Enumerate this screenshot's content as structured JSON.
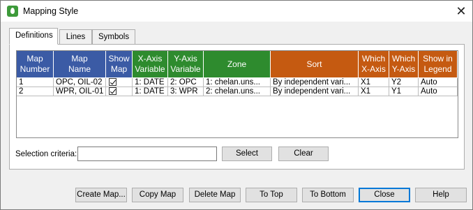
{
  "window": {
    "title": "Mapping Style"
  },
  "tabs": [
    {
      "label": "Definitions"
    },
    {
      "label": "Lines"
    },
    {
      "label": "Symbols"
    }
  ],
  "columns": [
    {
      "label": "Map\nNumber",
      "color": "#3b5ba5"
    },
    {
      "label": "Map\nName",
      "color": "#3b5ba5"
    },
    {
      "label": "Show\nMap",
      "color": "#3b5ba5"
    },
    {
      "label": "X-Axis\nVariable",
      "color": "#2e8b2e"
    },
    {
      "label": "Y-Axis\nVariable",
      "color": "#2e8b2e"
    },
    {
      "label": "Zone",
      "color": "#2e8b2e"
    },
    {
      "label": "Sort",
      "color": "#c55a11"
    },
    {
      "label": "Which\nX-Axis",
      "color": "#c55a11"
    },
    {
      "label": "Which\nY-Axis",
      "color": "#c55a11"
    },
    {
      "label": "Show in\nLegend",
      "color": "#c55a11"
    }
  ],
  "rows": [
    {
      "number": "1",
      "name": "OPC, OIL-02",
      "show_map": true,
      "x_var": "1: DATE",
      "y_var": "2: OPC",
      "zone": "1: chelan.uns...",
      "sort": "By independent vari...",
      "which_x": "X1",
      "which_y": "Y2",
      "legend": "Auto"
    },
    {
      "number": "2",
      "name": "WPR, OIL-01",
      "show_map": true,
      "x_var": "1: DATE",
      "y_var": "3: WPR",
      "zone": "2: chelan.uns...",
      "sort": "By independent vari...",
      "which_x": "X1",
      "which_y": "Y1",
      "legend": "Auto"
    }
  ],
  "selection": {
    "label": "Selection criteria:",
    "value": "",
    "select_label": "Select",
    "clear_label": "Clear"
  },
  "buttons": {
    "create_map": "Create Map...",
    "copy_map": "Copy Map",
    "delete_map": "Delete Map",
    "to_top": "To Top",
    "to_bottom": "To Bottom",
    "close": "Close",
    "help": "Help"
  }
}
